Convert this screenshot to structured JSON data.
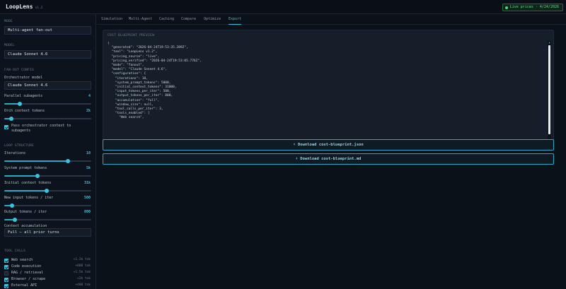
{
  "app": {
    "name": "LoopLens",
    "version": "v1.2",
    "live_label": "Live prices · 4/24/2026"
  },
  "sidebar": {
    "mode_section": "MODE",
    "mode_value": "Multi-agent fan-out",
    "model_section": "MODEL",
    "model_value": "Claude Sonnet 4.6",
    "fanout_section": "FAN-OUT CONFIG",
    "orchestrator_label": "Orchestrator model",
    "orchestrator_value": "Claude Sonnet 4.6",
    "parallel_label": "Parallel subagents",
    "parallel_value": "4",
    "parallel_pct": 18,
    "orch_ctx_label": "Orch context tokens",
    "orch_ctx_value": "2k",
    "orch_ctx_pct": 8,
    "pass_ctx_label": "Pass orchestrator context to subagents",
    "loop_section": "LOOP STRUCTURE",
    "iterations_label": "Iterations",
    "iterations_value": "10",
    "iterations_pct": 73,
    "sys_prompt_label": "System prompt tokens",
    "sys_prompt_value": "5k",
    "sys_prompt_pct": 38,
    "init_ctx_label": "Initial context tokens",
    "init_ctx_value": "31k",
    "init_ctx_pct": 49,
    "new_input_label": "New input tokens / iter",
    "new_input_value": "500",
    "new_input_pct": 9,
    "output_label": "Output tokens / iter",
    "output_value": "800",
    "output_pct": 12,
    "accum_label": "Context accumulation",
    "accum_value": "Full — all prior turns",
    "tools_section": "TOOL CALLS",
    "tools": [
      {
        "label": "Web search",
        "cost": "+1.3k tok",
        "on": true
      },
      {
        "label": "Code execution",
        "cost": "+800 tok",
        "on": true
      },
      {
        "label": "RAG / retrieval",
        "cost": "+1.5k tok",
        "on": false
      },
      {
        "label": "Browser / scrape",
        "cost": "+3k tok",
        "on": true
      },
      {
        "label": "External API",
        "cost": "+400 tok",
        "on": true
      }
    ]
  },
  "tabs": [
    "Simulation",
    "Multi-Agent",
    "Caching",
    "Compare",
    "Optimize",
    "Export"
  ],
  "active_tab": "Export",
  "preview": {
    "title": "COST BLUEPRINT PREVIEW",
    "lines": [
      "{",
      "  \"generated\": \"2026-04-24T19:53:35.209Z\",",
      "  \"tool\": \"LoopLens v1.2\",",
      "  \"pricing_source\": \"live\",",
      "  \"pricing_verified\": \"2026-04-24T19:53:05.776Z\",",
      "  \"mode\": \"fanout\",",
      "  \"model\": \"Claude Sonnet 4.6\",",
      "  \"configuration\": {",
      "    \"iterations\": 10,",
      "    \"system_prompt_tokens\": 5000,",
      "    \"initial_context_tokens\": 31000,",
      "    \"input_tokens_per_iter\": 500,",
      "    \"output_tokens_per_iter\": 800,",
      "    \"accumulation\": \"full\",",
      "    \"window_size\": null,",
      "    \"tool_calls_per_iter\": 3,",
      "    \"tools_enabled\": [",
      "      \"Web search\","
    ]
  },
  "buttons": {
    "download_json": "⬇ Download cost-blueprint.json",
    "download_md": "⬇ Download cost-blueprint.md"
  }
}
